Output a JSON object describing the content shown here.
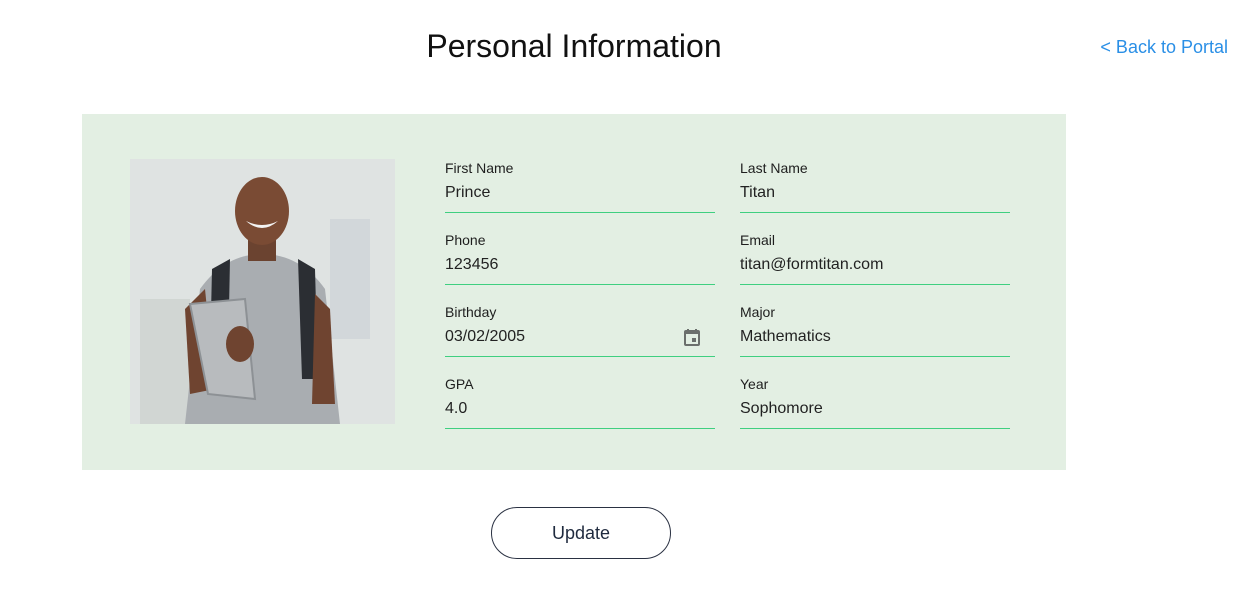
{
  "header": {
    "title": "Personal Information",
    "back_link": "< Back to Portal"
  },
  "profile": {
    "photo_alt": "Student photo"
  },
  "fields": {
    "first_name": {
      "label": "First Name",
      "value": "Prince"
    },
    "last_name": {
      "label": "Last Name",
      "value": "Titan"
    },
    "phone": {
      "label": "Phone",
      "value": "123456"
    },
    "email": {
      "label": "Email",
      "value": "titan@formtitan.com"
    },
    "birthday": {
      "label": "Birthday",
      "value": "03/02/2005",
      "icon": "calendar-icon"
    },
    "major": {
      "label": "Major",
      "value": "Mathematics"
    },
    "gpa": {
      "label": "GPA",
      "value": "4.0"
    },
    "year": {
      "label": "Year",
      "value": "Sophomore"
    }
  },
  "actions": {
    "update_label": "Update"
  },
  "colors": {
    "link": "#2a8fe6",
    "card_bg": "#e3efe3",
    "underline": "#3fcf80"
  }
}
